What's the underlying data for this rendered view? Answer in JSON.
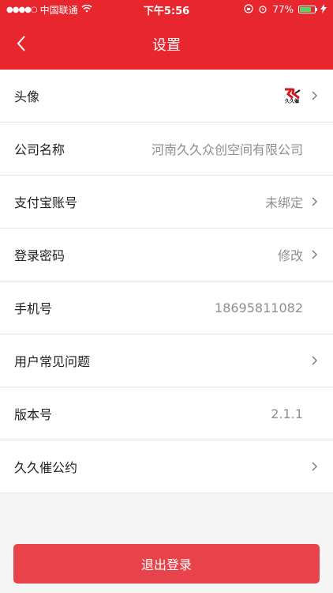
{
  "status": {
    "carrier": "中国联通",
    "time": "下午5:56",
    "battery": "77%",
    "battery_level": 0.77
  },
  "nav": {
    "title": "设置"
  },
  "rows": [
    {
      "label": "头像",
      "value": "",
      "has_arrow": true
    },
    {
      "label": "公司名称",
      "value": "河南久久众创空间有限公司",
      "has_arrow": false
    },
    {
      "label": "支付宝账号",
      "value": "未绑定",
      "has_arrow": true
    },
    {
      "label": "登录密码",
      "value": "修改",
      "has_arrow": true
    },
    {
      "label": "手机号",
      "value": "18695811082",
      "has_arrow": false
    },
    {
      "label": "用户常见问题",
      "value": "",
      "has_arrow": true
    },
    {
      "label": "版本号",
      "value": "2.1.1",
      "has_arrow": false
    },
    {
      "label": "久久催公约",
      "value": "",
      "has_arrow": true
    }
  ],
  "logo_text": "久久催",
  "logout_label": "退出登录",
  "colors": {
    "brand": "#e8262e",
    "logout": "#e8424a"
  }
}
